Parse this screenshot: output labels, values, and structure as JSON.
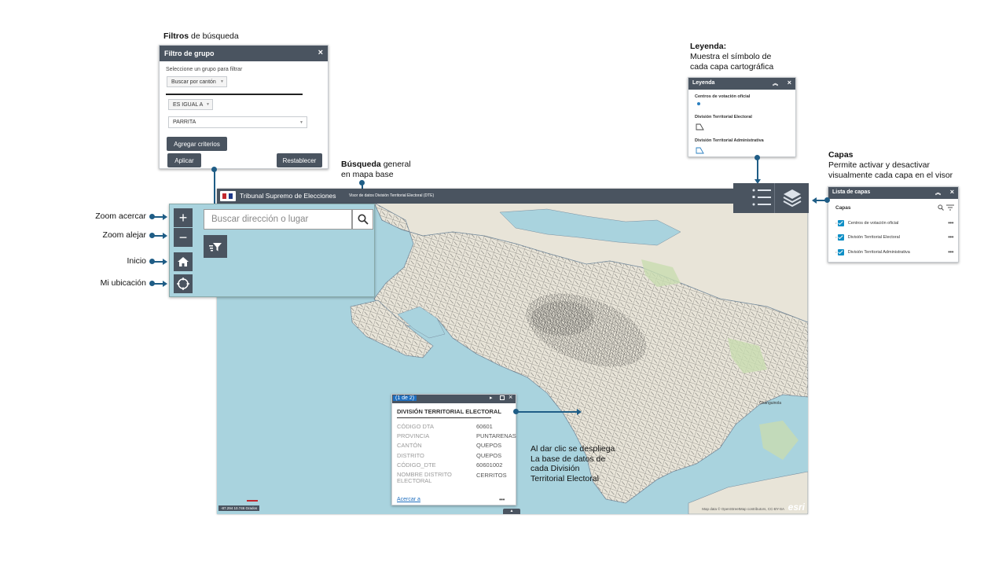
{
  "annotations": {
    "filtros_bold": "Filtros",
    "filtros_rest": "de búsqueda",
    "leyenda_bold": "Leyenda:",
    "leyenda_l1": "Muestra el símbolo de",
    "leyenda_l2": "cada capa cartográfica",
    "capas_bold": "Capas",
    "capas_l1": "Permite activar y desactivar",
    "capas_l2": "visualmente cada capa en el visor",
    "busqueda_bold": "Búsqueda",
    "busqueda_rest": "general",
    "busqueda_l2": "en mapa base",
    "zoom_in": "Zoom acercar",
    "zoom_out": "Zoom alejar",
    "inicio": "Inicio",
    "ubicacion": "Mi ubicación",
    "popup_l1": "Al dar clic se despliega",
    "popup_l2": "La base de datos de",
    "popup_l3": "cada División",
    "popup_l4": "Territorial Electoral"
  },
  "filter": {
    "title": "Filtro de grupo",
    "close": "×",
    "prompt": "Seleccione un grupo para filtrar",
    "group_select": "Buscar por cantón",
    "operator": "ES IGUAL A",
    "value": "PARRITA",
    "add": "Agregar criterios",
    "apply": "Aplicar",
    "reset": "Restablecer"
  },
  "legend": {
    "title": "Leyenda",
    "items": [
      "Centros de votación oficial",
      "División Territorial Electoral",
      "División Territorial Administrativa"
    ]
  },
  "layers": {
    "title": "Lista de capas",
    "section": "Capas",
    "items": [
      "Centros de votación oficial",
      "División Territorial Electoral",
      "División Territorial Administrativa"
    ],
    "more": "•••"
  },
  "app": {
    "title": "Tribunal Supremo de Elecciones",
    "subtitle": "Visor de datos División Territorial Electoral (DTE)"
  },
  "search": {
    "placeholder": "Buscar dirección o lugar"
  },
  "popup": {
    "counter": "(1 de 2)",
    "heading": "DIVISIÓN TERRITORIAL ELECTORAL",
    "fields": [
      {
        "label": "CÓDIGO DTA",
        "value": "60601"
      },
      {
        "label": "PROVINCIA",
        "value": "PUNTARENAS"
      },
      {
        "label": "CANTÓN",
        "value": "QUEPOS"
      },
      {
        "label": "DISTRITO",
        "value": "QUEPOS"
      },
      {
        "label": "CÓDIGO_DTE",
        "value": "60601002"
      },
      {
        "label": "NOMBRE DISTRITO ELECTORAL",
        "value": "CERRITOS"
      }
    ],
    "zoom_link": "Acercar a",
    "more": "•••"
  },
  "map": {
    "attribution": "Map data © OpenStreetMap contributors, CC-BY-SA",
    "coords": "-87.294 10.746 Grados",
    "esri": "esri",
    "place_label": "Changuinola",
    "colors": {
      "water": "#a9d3de",
      "land": "#e8e4d8",
      "lines": "#3a3a3a",
      "park": "#c8dcb0"
    }
  },
  "colors": {
    "panel": "#4a5460",
    "accent": "#1f5d86",
    "check": "#0f8fc6"
  }
}
